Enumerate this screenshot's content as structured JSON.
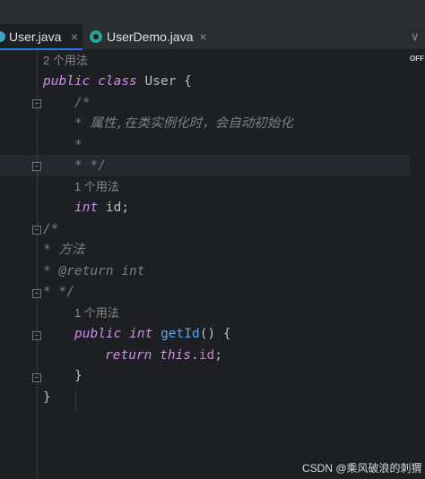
{
  "tabs": [
    {
      "label": "User.java",
      "close": "×"
    },
    {
      "label": "UserDemo.java",
      "close": "×"
    }
  ],
  "tabs_overflow": "∨",
  "badge": "OFF",
  "code": {
    "usage_2": "2 个用法",
    "class_public": "public",
    "class_kw": "class",
    "class_decl": " User {",
    "doc1_open": "/*",
    "doc1_text": "* 属性,在类实例化时，会自动初始化",
    "doc1_star": "*",
    "doc1_close": "* */",
    "usage_1a": "1 个用法",
    "field_type": "int",
    "field_rest": " id;",
    "doc2_open": "/*",
    "doc2_text": "* 方法",
    "doc2_return": "* @return int",
    "doc2_close": "* */",
    "usage_1b": "1 个用法",
    "m_public": "public",
    "m_type": "int",
    "m_name": "getId",
    "m_rest": "() {",
    "ret_kw": "return",
    "ret_this": "this",
    "ret_dot": ".",
    "ret_field": "id",
    "ret_semi": ";",
    "m_close": "}",
    "class_close": "}"
  },
  "watermark": "CSDN @乘风破浪的刺猬"
}
